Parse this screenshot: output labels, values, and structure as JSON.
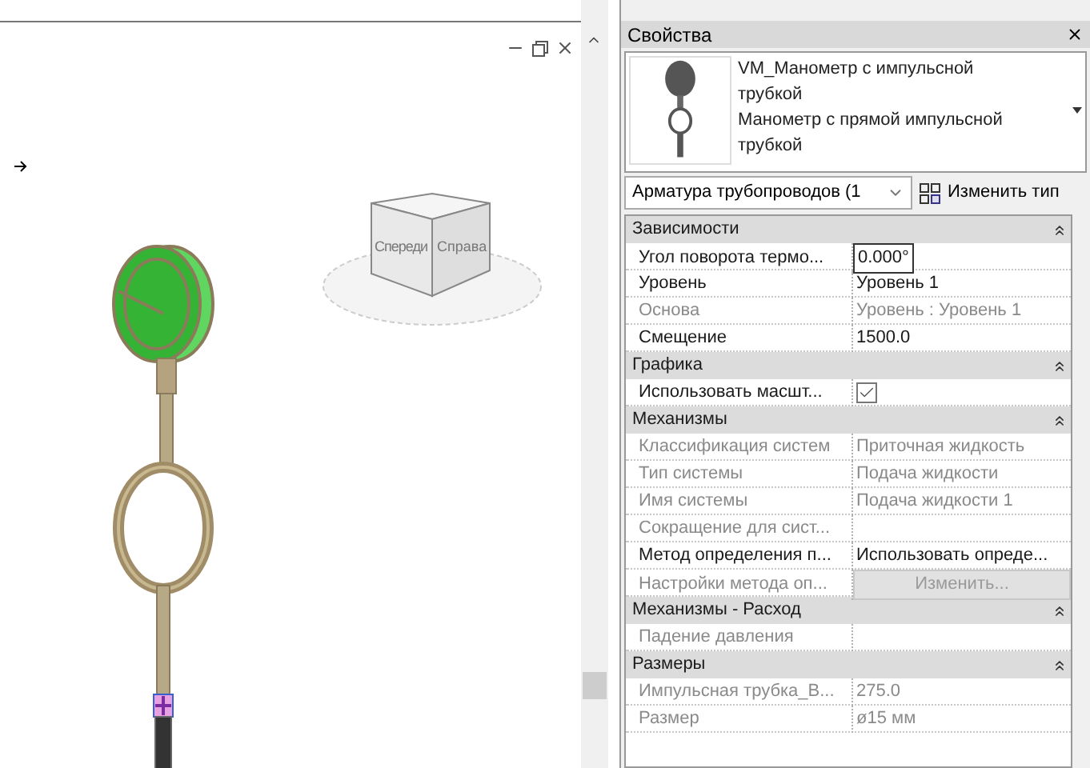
{
  "viewcube": {
    "front_label": "Спереди",
    "right_label": "Справа"
  },
  "properties": {
    "title": "Свойства",
    "type_selector": {
      "family": "VM_Манометр с импульсной трубкой",
      "type": "Манометр с прямой импульсной трубкой"
    },
    "category_filter": "Арматура трубопроводов (1",
    "edit_type_button": "Изменить тип",
    "sections": [
      {
        "title": "Зависимости",
        "expanded": true,
        "rows": [
          {
            "label": "Угол поворота термо...",
            "value": "0.000°",
            "kind": "field",
            "disabled": false
          },
          {
            "label": "Уровень",
            "value": "Уровень 1",
            "kind": "text",
            "disabled": false
          },
          {
            "label": "Основа",
            "value": "Уровень : Уровень 1",
            "kind": "text",
            "disabled": true
          },
          {
            "label": "Смещение",
            "value": "1500.0",
            "kind": "text",
            "disabled": false
          }
        ]
      },
      {
        "title": "Графика",
        "expanded": true,
        "rows": [
          {
            "label": "Использовать масшт...",
            "checked": true,
            "kind": "checkbox",
            "disabled": false
          }
        ]
      },
      {
        "title": "Механизмы",
        "expanded": true,
        "rows": [
          {
            "label": "Классификация систем",
            "value": "Приточная жидкость",
            "kind": "text",
            "disabled": true
          },
          {
            "label": "Тип системы",
            "value": "Подача жидкости",
            "kind": "text",
            "disabled": true
          },
          {
            "label": "Имя системы",
            "value": "Подача жидкости 1",
            "kind": "text",
            "disabled": true
          },
          {
            "label": "Сокращение для сист...",
            "kind": "text",
            "disabled": true
          },
          {
            "label": "Метод определения п...",
            "value": "Использовать опреде...",
            "kind": "text",
            "disabled": false
          },
          {
            "label": "Настройки метода оп...",
            "value": "Изменить...",
            "kind": "button",
            "disabled": true
          }
        ]
      },
      {
        "title": "Механизмы - Расход",
        "expanded": true,
        "rows": [
          {
            "label": "Падение давления",
            "kind": "text",
            "disabled": true
          }
        ]
      },
      {
        "title": "Размеры",
        "expanded": true,
        "rows": [
          {
            "label": "Импульсная трубка_В...",
            "value": "275.0",
            "kind": "text",
            "disabled": true
          },
          {
            "label": "Размер",
            "value": "ø15 мм",
            "kind": "text",
            "disabled": true
          }
        ]
      }
    ]
  }
}
